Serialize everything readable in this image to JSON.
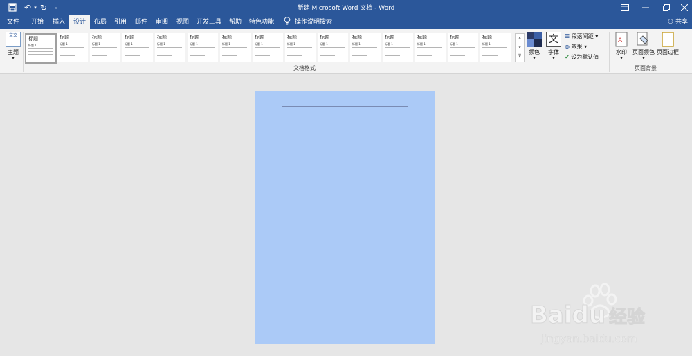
{
  "window": {
    "title": "新建 Microsoft Word 文档 - Word",
    "controls": [
      "ribbon-display-icon",
      "minimize-icon",
      "restore-icon",
      "close-icon"
    ]
  },
  "quick_access": [
    {
      "name": "save-icon",
      "glyph": "🖫"
    },
    {
      "name": "undo-icon",
      "glyph": "↶"
    },
    {
      "name": "redo-icon",
      "glyph": "↻"
    },
    {
      "name": "customize-qat-icon",
      "glyph": "▿"
    }
  ],
  "tabs": [
    "文件",
    "开始",
    "插入",
    "设计",
    "布局",
    "引用",
    "邮件",
    "审阅",
    "视图",
    "开发工具",
    "帮助",
    "特色功能"
  ],
  "active_tab": "设计",
  "tell_me": "操作说明搜索",
  "share": "共享",
  "ribbon": {
    "theme_label": "主题",
    "theme_icon_text": "文文",
    "style_gallery": [
      {
        "h1": "标题",
        "h2": "标题 1"
      },
      {
        "h1": "标题",
        "h2": "标题 1"
      },
      {
        "h1": "标题",
        "h2": "标题 1"
      },
      {
        "h1": "标题",
        "h2": "标题 1"
      },
      {
        "h1": "标题",
        "h2": "标题 1"
      },
      {
        "h1": "标题",
        "h2": "标题 1"
      },
      {
        "h1": "标题",
        "h2": "标题 1"
      },
      {
        "h1": "标题",
        "h2": "标题 1"
      },
      {
        "h1": "标题",
        "h2": "标题 1"
      },
      {
        "h1": "标题",
        "h2": "标题 1"
      },
      {
        "h1": "标题",
        "h2": "标题 1"
      },
      {
        "h1": "标题",
        "h2": "标题 1"
      },
      {
        "h1": "标题",
        "h2": "标题 1"
      },
      {
        "h1": "标题",
        "h2": "标题 1"
      },
      {
        "h1": "标题",
        "h2": "标题 1"
      }
    ],
    "doc_format_group_label": "文档格式",
    "colors_label": "颜色",
    "fonts_label": "字体",
    "fonts_icon_text": "文",
    "paragraph_spacing_label": "段落间距",
    "effects_label": "效果",
    "set_default_label": "设为默认值",
    "watermark_label": "水印",
    "page_color_label": "页面颜色",
    "page_borders_label": "页面边框",
    "page_bg_group_label": "页面背景"
  },
  "colors": {
    "title_bar": "#2b579a",
    "ribbon": "#f3f3f3",
    "canvas": "#e6e6e6",
    "page": "#abcaf7"
  },
  "watermark": {
    "brand": "Baidu",
    "cn": "经验",
    "url": "jingyan.baidu.com"
  }
}
